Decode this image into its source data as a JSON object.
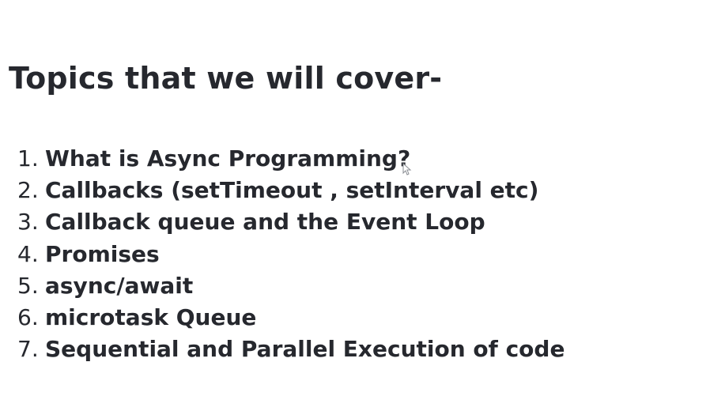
{
  "slide": {
    "title": "Topics that we will cover-",
    "topics": [
      {
        "number": "1.",
        "text": "What is Async Programming?"
      },
      {
        "number": "2.",
        "text": "Callbacks (setTimeout , setInterval etc)"
      },
      {
        "number": "3.",
        "text": "Callback queue and the Event Loop"
      },
      {
        "number": "4.",
        "text": "Promises"
      },
      {
        "number": "5.",
        "text": "async/await"
      },
      {
        "number": "6.",
        "text": "microtask Queue"
      },
      {
        "number": "7.",
        "text": "Sequential and Parallel Execution of code"
      }
    ]
  },
  "colors": {
    "background": "#ffffff",
    "text": "#26282e"
  },
  "icons": {
    "cursor": "mouse-pointer-icon"
  }
}
